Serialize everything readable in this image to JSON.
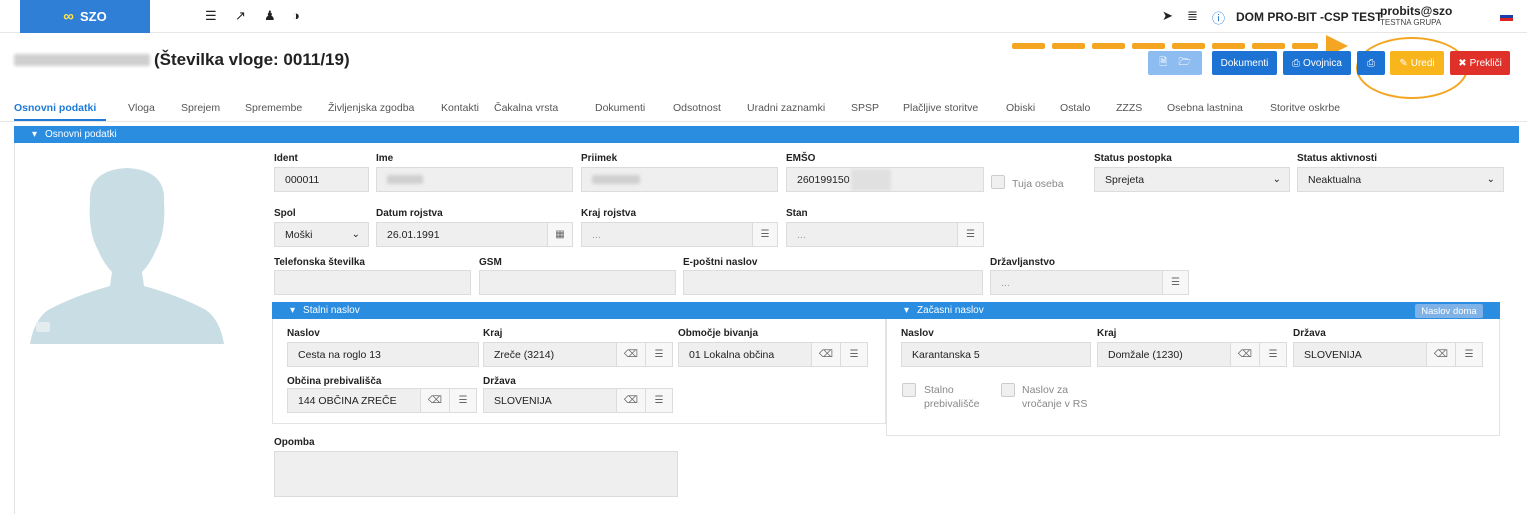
{
  "app": {
    "logo_text": "SZO"
  },
  "topbar": {
    "org": "DOM PRO-BIT -CSP TEST",
    "user": "probits@szo",
    "group": "TESTNA GRUPA"
  },
  "header": {
    "title": "(Številka vloge: 0011/19)"
  },
  "buttons": {
    "dokumenti": "Dokumenti",
    "ovojnica": "Ovojnica",
    "uredi": "Uredi",
    "preklici": "Prekliči"
  },
  "tabs": [
    "Osnovni podatki",
    "Vloga",
    "Sprejem",
    "Spremembe",
    "Življenjska zgodba",
    "Kontakti",
    "Čakalna vrsta",
    "Dokumenti",
    "Odsotnost",
    "Uradni zaznamki",
    "SPSP",
    "Plačljive storitve",
    "Obiski",
    "Ostalo",
    "ZZZS",
    "Osebna lastnina",
    "Storitve oskrbe"
  ],
  "section": {
    "title": "Osnovni podatki"
  },
  "form": {
    "ident_label": "Ident",
    "ident": "000011",
    "ime_label": "Ime",
    "priimek_label": "Priimek",
    "emso_label": "EMŠO",
    "emso": "260199150",
    "tuja_oseba": "Tuja oseba",
    "status_postopka_label": "Status postopka",
    "status_postopka": "Sprejeta",
    "status_aktivnosti_label": "Status aktivnosti",
    "status_aktivnosti": "Neaktualna",
    "spol_label": "Spol",
    "spol": "Moški",
    "datum_label": "Datum rojstva",
    "datum": "26.01.1991",
    "kraj_rojstva_label": "Kraj rojstva",
    "kraj_rojstva_ph": "...",
    "stan_label": "Stan",
    "stan_ph": "...",
    "telefon_label": "Telefonska številka",
    "gsm_label": "GSM",
    "email_label": "E-poštni naslov",
    "drzavljanstvo_label": "Državljanstvo",
    "drzavljanstvo_ph": "...",
    "opomba_label": "Opomba"
  },
  "stalni": {
    "title": "Stalni naslov",
    "naslov_label": "Naslov",
    "naslov": "Cesta na roglo 13",
    "kraj_label": "Kraj",
    "kraj": "Zreče (3214)",
    "obmocje_label": "Območje bivanja",
    "obmocje": "01 Lokalna občina",
    "obcina_label": "Občina prebivališča",
    "obcina": "144  OBČINA ZREČE",
    "drzava_label": "Država",
    "drzava": "SLOVENIJA"
  },
  "zacasni": {
    "title": "Začasni naslov",
    "badge": "Naslov doma",
    "naslov_label": "Naslov",
    "naslov": "Karantanska 5",
    "kraj_label": "Kraj",
    "kraj": "Domžale (1230)",
    "drzava_label": "Država",
    "drzava": "SLOVENIJA",
    "stalno_1": "Stalno",
    "stalno_2": "prebivališče",
    "vrocanje_1": "Naslov za",
    "vrocanje_2": "vročanje v RS"
  },
  "colors": {
    "primary": "#2a8de0",
    "warning": "#f9b51c",
    "danger": "#e0302a",
    "highlight": "#f4a622"
  }
}
